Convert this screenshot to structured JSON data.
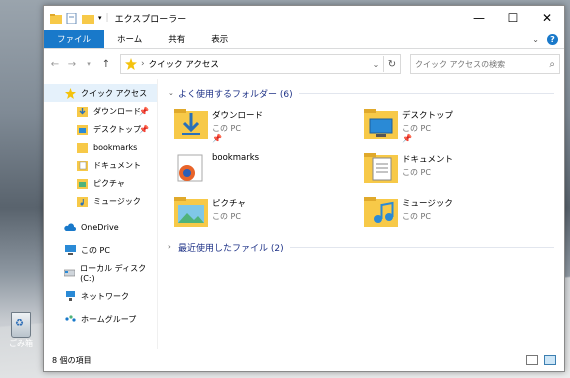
{
  "window": {
    "title": "エクスプローラー",
    "controls": {
      "minimize": "—",
      "maximize": "☐",
      "close": "✕"
    }
  },
  "ribbon": {
    "tabs": [
      "ファイル",
      "ホーム",
      "共有",
      "表示"
    ]
  },
  "address": {
    "path": "クイック アクセス",
    "search_placeholder": "クイック アクセスの検索"
  },
  "nav_pane": {
    "items": [
      {
        "label": "クイック アクセス",
        "icon": "star-icon",
        "selected": true
      },
      {
        "label": "ダウンロード",
        "icon": "download-folder-icon",
        "pinned": true
      },
      {
        "label": "デスクトップ",
        "icon": "desktop-folder-icon",
        "pinned": true
      },
      {
        "label": "bookmarks",
        "icon": "folder-icon"
      },
      {
        "label": "ドキュメント",
        "icon": "documents-folder-icon"
      },
      {
        "label": "ピクチャ",
        "icon": "pictures-folder-icon"
      },
      {
        "label": "ミュージック",
        "icon": "music-folder-icon"
      },
      {
        "label": "OneDrive",
        "icon": "onedrive-icon"
      },
      {
        "label": "この PC",
        "icon": "pc-icon"
      },
      {
        "label": "ローカル ディスク (C:)",
        "icon": "disk-icon"
      },
      {
        "label": "ネットワーク",
        "icon": "network-icon"
      },
      {
        "label": "ホームグループ",
        "icon": "homegroup-icon"
      }
    ]
  },
  "content": {
    "frequent_header": "よく使用するフォルダー (6)",
    "recent_header": "最近使用したファイル (2)",
    "folders": [
      {
        "name": "ダウンロード",
        "location": "この PC",
        "pinned": true,
        "icon": "download-folder-icon"
      },
      {
        "name": "デスクトップ",
        "location": "この PC",
        "pinned": true,
        "icon": "desktop-folder-icon"
      },
      {
        "name": "bookmarks",
        "location": "",
        "pinned": false,
        "icon": "firefox-folder-icon"
      },
      {
        "name": "ドキュメント",
        "location": "この PC",
        "pinned": false,
        "icon": "documents-folder-icon"
      },
      {
        "name": "ピクチャ",
        "location": "この PC",
        "pinned": false,
        "icon": "pictures-folder-icon"
      },
      {
        "name": "ミュージック",
        "location": "この PC",
        "pinned": false,
        "icon": "music-folder-icon"
      }
    ]
  },
  "status": {
    "count": "8 個の項目"
  },
  "desktop": {
    "recycle_label": "ごみ箱"
  },
  "colors": {
    "accent": "#1979ca",
    "folder": "#f7c948",
    "header_text": "#1e3287"
  }
}
